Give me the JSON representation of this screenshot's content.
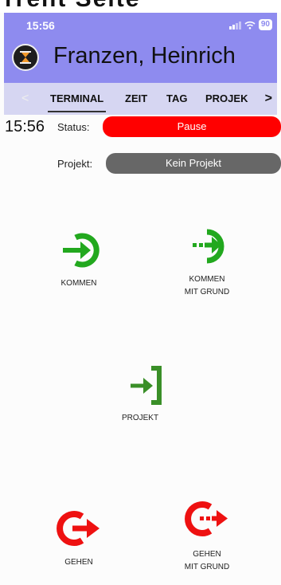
{
  "watermark_text": "rrent Seite",
  "status_bar": {
    "time": "15:56",
    "battery": "90"
  },
  "header": {
    "user_name": "Franzen, Heinrich"
  },
  "tabs": [
    {
      "label": "TERMINAL",
      "active": true
    },
    {
      "label": "ZEIT",
      "active": false
    },
    {
      "label": "TAG",
      "active": false
    },
    {
      "label": "PROJEK",
      "active": false
    }
  ],
  "status": {
    "time": "15:56",
    "label": "Status:",
    "value": "Pause",
    "color": "#ff0000"
  },
  "project": {
    "label": "Projekt:",
    "value": "Kein Projekt",
    "color": "#676767"
  },
  "actions": {
    "kommen": {
      "line1": "KOMMEN",
      "icon": "login-icon",
      "color": "#22a81e"
    },
    "kommen_grund": {
      "line1": "KOMMEN",
      "line2": "MIT GRUND",
      "icon": "login-dotted-icon",
      "color": "#22a81e"
    },
    "projekt": {
      "line1": "PROJEKT",
      "icon": "project-enter-icon",
      "color": "#22a81e"
    },
    "gehen": {
      "line1": "GEHEN",
      "icon": "logout-icon",
      "color": "#ee1111"
    },
    "gehen_grund": {
      "line1": "GEHEN",
      "line2": "MIT GRUND",
      "icon": "logout-dotted-icon",
      "color": "#ee1111"
    }
  }
}
